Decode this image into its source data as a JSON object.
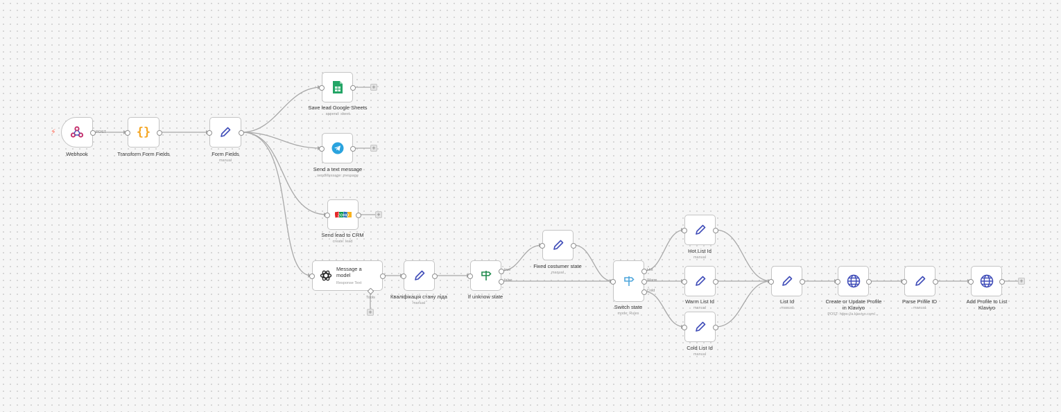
{
  "nodes": {
    "webhook": {
      "title": "Webhook",
      "icon": "webhook-icon"
    },
    "transform": {
      "title": "Transform Form Fields",
      "icon": "code-braces-icon"
    },
    "form_fields": {
      "title": "Form Fields",
      "sub": "manual",
      "icon": "pencil-icon"
    },
    "sheets": {
      "title": "Save lead Google Sheets",
      "sub": "append: sheet",
      "icon": "google-sheets-icon"
    },
    "telegram": {
      "title": "Send a text message",
      "sub": "sendMessage: message",
      "icon": "telegram-icon"
    },
    "crm": {
      "title": "Send lead to CRM",
      "sub": "create: lead",
      "icon": "zoho-crm-icon",
      "logo_text": "ZOHO"
    },
    "model": {
      "title": "Message a model",
      "sub": "Response Text",
      "icon": "openai-icon"
    },
    "kval": {
      "title": "Кваліфікація стану ліда",
      "sub": "manual",
      "icon": "pencil-icon"
    },
    "if_state": {
      "title": "If unknow state",
      "icon": "signpost-icon"
    },
    "fixed": {
      "title": "Fixed costumer state",
      "sub": "manual",
      "icon": "pencil-icon"
    },
    "switch": {
      "title": "Switch state",
      "sub": "mode: Rules",
      "icon": "switch-signpost-icon"
    },
    "hot": {
      "title": "Hot List Id",
      "sub": "manual",
      "icon": "pencil-icon"
    },
    "warm": {
      "title": "Warm List Id",
      "sub": "manual",
      "icon": "pencil-icon"
    },
    "cold": {
      "title": "Cold List Id",
      "sub": "manual",
      "icon": "pencil-icon"
    },
    "list_id": {
      "title": "List Id",
      "sub": "manual",
      "icon": "pencil-icon"
    },
    "create_profile": {
      "title": "Create or Update Profile in Klaviyo",
      "sub": "POST: https://a.klaviyo.com/...",
      "icon": "globe-icon"
    },
    "parse": {
      "title": "Parse Prifile ID",
      "sub": "manual",
      "icon": "pencil-icon"
    },
    "add_profile": {
      "title": "Add Profile to List Klaviyo",
      "icon": "globe-icon"
    }
  },
  "edge_labels": {
    "post": "POST",
    "true": "true",
    "false": "false",
    "hot": "Hot",
    "warm": "Warm",
    "cold": "Cold",
    "tools": "Tools"
  },
  "plus_symbol": "+",
  "colors": {
    "pencil": "#3f4cb8",
    "sheets": "#23a566",
    "telegram": "#2aa3de",
    "webhook": "#c5326e",
    "braces": "#f5a623",
    "signpost": "#1f8a4c",
    "switch": "#4ea6dc",
    "globe": "#3f4cb8",
    "edge": "#a8a8a8",
    "trigger_bolt": "#ff6d5a"
  }
}
